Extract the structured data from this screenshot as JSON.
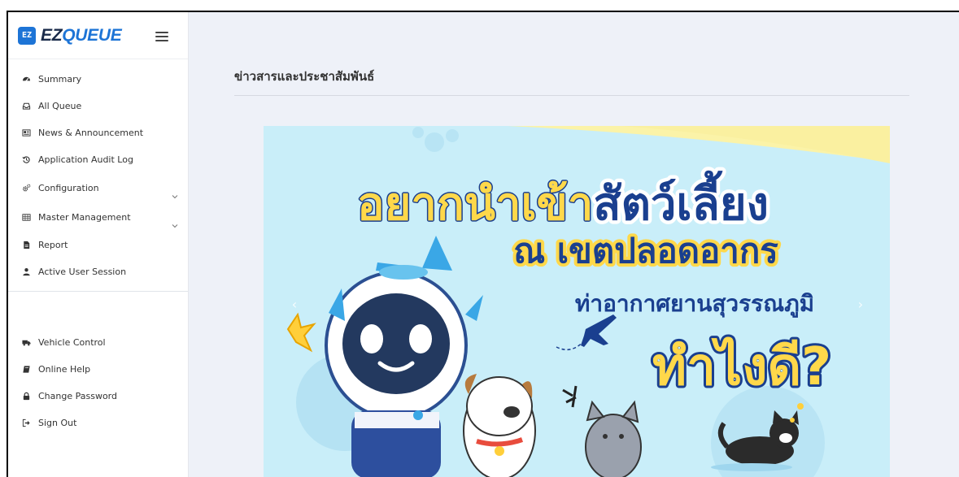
{
  "brand": {
    "logo_text": "EZ",
    "name_part1": "EZ",
    "name_part2": "QUEUE"
  },
  "sidebar": {
    "items": [
      {
        "label": "Summary",
        "icon": "dashboard-icon"
      },
      {
        "label": "All Queue",
        "icon": "inbox-icon"
      },
      {
        "label": "News & Announcement",
        "icon": "newspaper-icon"
      },
      {
        "label": "Application Audit Log",
        "icon": "history-icon"
      },
      {
        "label": "Configuration",
        "icon": "cogs-icon",
        "has_children": true
      },
      {
        "label": "Master Management",
        "icon": "table-icon",
        "has_children": true
      },
      {
        "label": "Report",
        "icon": "file-icon"
      },
      {
        "label": "Active User Session",
        "icon": "user-icon"
      }
    ],
    "bottom_items": [
      {
        "label": "Vehicle Control",
        "icon": "truck-icon"
      },
      {
        "label": "Online Help",
        "icon": "book-icon"
      },
      {
        "label": "Change Password",
        "icon": "lock-icon"
      },
      {
        "label": "Sign Out",
        "icon": "sign-out-icon"
      }
    ]
  },
  "main": {
    "title": "ข่าวสารและประชาสัมพันธ์",
    "banner": {
      "line1_prefix": "อยากนำเข้า",
      "line1_suffix": "สัตว์เลี้ยง",
      "line2": "ณ เขตปลอดอากร",
      "line3": "ท่าอากาศยานสุวรรณภูมิ",
      "line4": "ทำไงดี?"
    },
    "carousel": {
      "prev_glyph": "‹",
      "next_glyph": "›"
    }
  },
  "colors": {
    "accent": "#1d74d6",
    "banner_bg": "#c9eef9",
    "banner_yellow": "#fbf3a8",
    "headline_blue": "#1a3f8f",
    "headline_yellow": "#ffd84a"
  }
}
